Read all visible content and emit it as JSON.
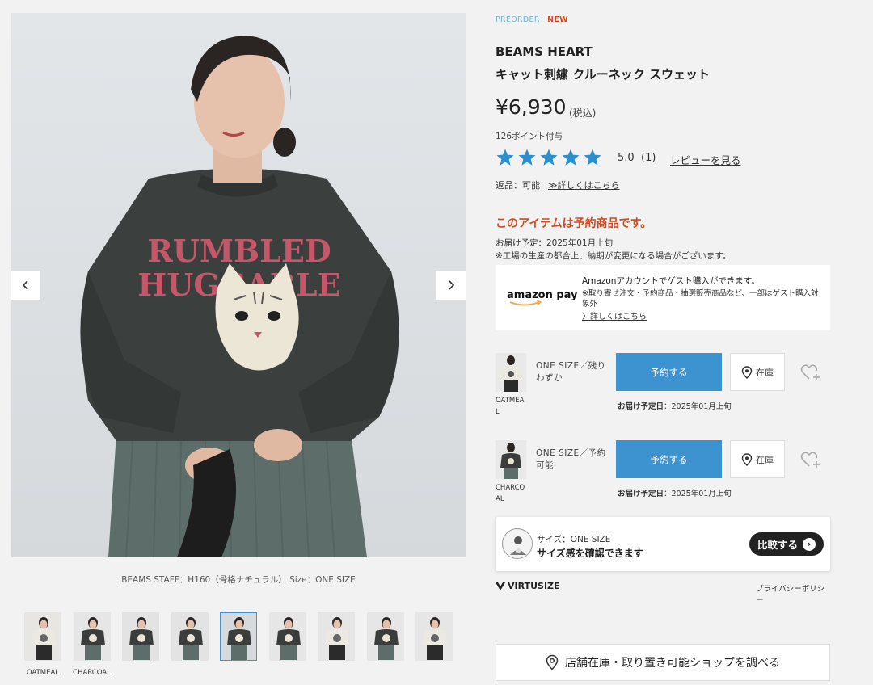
{
  "gallery": {
    "staff_caption": "BEAMS STAFF：H160（骨格ナチュラル） Size：ONE SIZE",
    "thumbnails": [
      {
        "label": "OATMEAL",
        "tone": "#e8e6e2",
        "shirt": "#ece9e3"
      },
      {
        "label": "CHARCOAL",
        "tone": "#e6e6e6",
        "shirt": "#3a3d3c"
      },
      {
        "label": "",
        "tone": "#e3e3e3",
        "shirt": "#3a3d3c"
      },
      {
        "label": "",
        "tone": "#e3e3e3",
        "shirt": "#3a3d3c"
      },
      {
        "label": "",
        "tone": "#d6dadc",
        "shirt": "#3a3d3c"
      },
      {
        "label": "",
        "tone": "#e6e6e6",
        "shirt": "#3a3d3c"
      },
      {
        "label": "",
        "tone": "#e6e6e6",
        "shirt": "#ece9e3"
      },
      {
        "label": "",
        "tone": "#e6e6e6",
        "shirt": "#3a3d3c"
      },
      {
        "label": "",
        "tone": "#e6e6e6",
        "shirt": "#ece9e3"
      }
    ],
    "active_thumbnail": 4,
    "shirt_print_line1": "RUMBLED",
    "shirt_print_line2": "HUGGABLE"
  },
  "product": {
    "tag_preorder": "PREORDER",
    "tag_new": "NEW",
    "brand": "BEAMS HEART",
    "title": "キャット刺繍 クルーネック スウェット",
    "price": "¥6,930",
    "tax": "(税込)",
    "points": "126ポイント付与",
    "rating": "5.0",
    "rating_count": "(1)",
    "star_count": 5,
    "review_link": "レビューを見る",
    "returns": "返品：可能",
    "returns_link": "≫詳しくはこちら",
    "reserve_heading": "このアイテムは予約商品です。",
    "delivery_estimate": "お届け予定：2025年01月上旬",
    "factory_note": "※工場の生産の都合上、納期が変更になる場合がございます。"
  },
  "amazon": {
    "logo": "amazon pay",
    "line1": "Amazonアカウントでゲスト購入ができます。",
    "note": "※取り寄せ注文・予約商品・抽選販売商品など、一部はゲスト購入対象外",
    "link": "〉詳しくはこちら"
  },
  "variants": [
    {
      "color": "OATMEAL",
      "size_status": "ONE SIZE／残りわずか",
      "button": "予約する",
      "stock": "在庫",
      "delivery_label": "お届け予定日",
      "delivery_value": "：2025年01月上旬"
    },
    {
      "color": "CHARCOAL",
      "size_status": "ONE SIZE／予約可能",
      "button": "予約する",
      "stock": "在庫",
      "delivery_label": "お届け予定日",
      "delivery_value": "：2025年01月上旬"
    }
  ],
  "virtusize": {
    "size": "サイズ：ONE SIZE",
    "check": "サイズ感を確認できます",
    "compare": "比較する",
    "logo": "VIRTUSIZE",
    "privacy": "プライバシーポリシー"
  },
  "store": {
    "label": "店舗在庫・取り置き可能ショップを調べる"
  },
  "colors": {
    "accent_blue": "#3d93d0",
    "reserve_red": "#d2491e",
    "star_blue": "#2a8fcf",
    "preorder_blue": "#6fb3d6"
  }
}
